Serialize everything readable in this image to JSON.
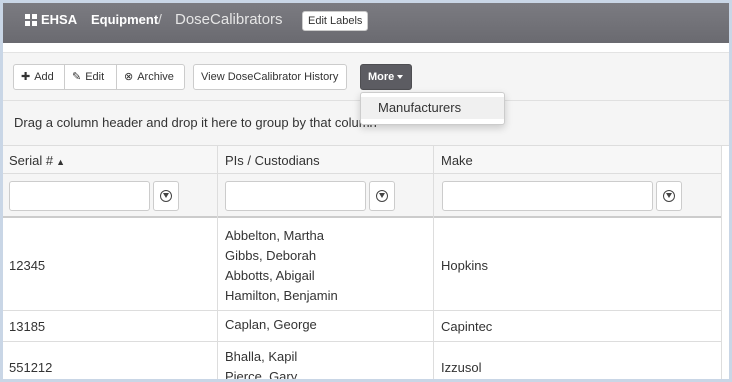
{
  "header": {
    "brand": "EHSA",
    "breadcrumb": [
      "Equipment",
      "DoseCalibrators"
    ],
    "separator": "/",
    "edit_labels": "Edit Labels"
  },
  "toolbar": {
    "add_label": "Add",
    "edit_label": "Edit",
    "archive_label": "Archive",
    "history_label": "View DoseCalibrator History",
    "more_label": "More"
  },
  "more_menu": {
    "items": [
      "Manufacturers"
    ]
  },
  "group_bar": {
    "text": "Drag a column header and drop it here to group by that column"
  },
  "grid": {
    "columns": [
      "Serial #",
      "PIs / Custodians",
      "Make"
    ],
    "sort_indicator": "▲",
    "filters": [
      "",
      "",
      ""
    ],
    "rows": [
      {
        "serial": "12345",
        "custodians": [
          "Abbelton, Martha",
          "Gibbs, Deborah",
          "Abbotts, Abigail",
          "Hamilton, Benjamin"
        ],
        "make": "Hopkins"
      },
      {
        "serial": "13185",
        "custodians": [
          "Caplan, George"
        ],
        "make": "Capintec"
      },
      {
        "serial": "551212",
        "custodians": [
          "Bhalla, Kapil",
          "Pierce, Gary"
        ],
        "make": "Izzusol"
      }
    ]
  },
  "colors": {
    "header_bg": "#6f6f75",
    "more_button_bg": "#5c5c62",
    "page_border": "#c9d6e6"
  }
}
